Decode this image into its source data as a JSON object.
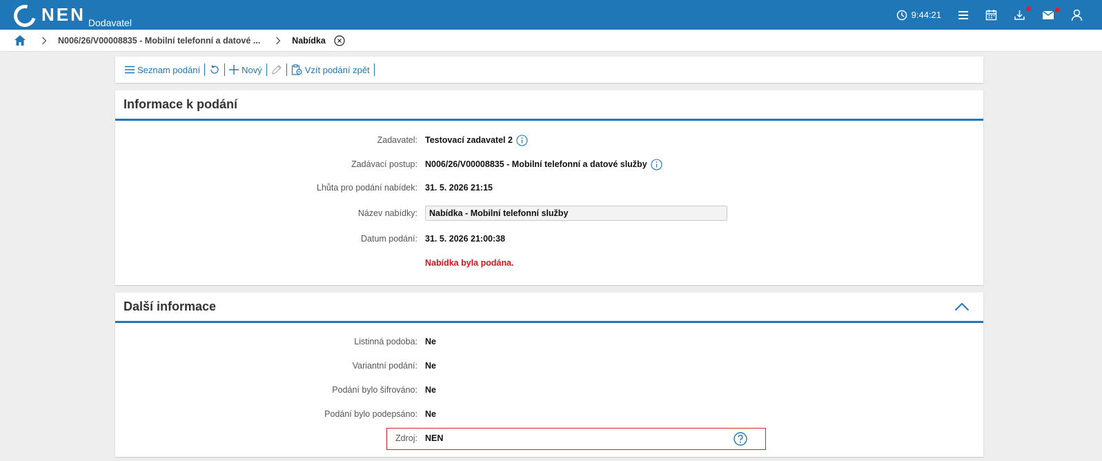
{
  "header": {
    "logo_text": "NEN",
    "logo_sub": "Dodavatel",
    "time": "9:44:21",
    "icons": [
      "clock-icon",
      "menu-icon",
      "calendar-icon",
      "download-icon",
      "mail-icon",
      "user-icon"
    ],
    "accent": "#1f77b8"
  },
  "breadcrumb": {
    "procedure": "N006/26/V00008835 - Mobilní telefonní a datové ...",
    "current": "Nabídka"
  },
  "toolbar": {
    "list_label": "Seznam podání",
    "new_label": "Nový",
    "withdraw_label": "Vzít podání zpět"
  },
  "info": {
    "title": "Informace k podání",
    "fields": [
      {
        "label": "Zadavatel:",
        "value": "Testovací zadavatel 2"
      },
      {
        "label": "Zadávací postup:",
        "value": "N006/26/V00008835 - Mobilní telefonní a datové služby"
      },
      {
        "label": "Lhůta pro podání nabídek:",
        "value": "31. 5. 2026 21:15"
      },
      {
        "label": "Název nabídky:",
        "value": "Nabídka - Mobilní telefonní služby"
      },
      {
        "label": "Datum podání:",
        "value": "31. 5. 2026 21:00:38"
      }
    ],
    "status": "Nabídka byla podána.",
    "status_color": "#e0101a"
  },
  "more": {
    "title": "Další informace",
    "fields": [
      {
        "label": "Listinná podoba:",
        "value": "Ne"
      },
      {
        "label": "Variantní podání:",
        "value": "Ne"
      },
      {
        "label": "Podání bylo šifrováno:",
        "value": "Ne"
      },
      {
        "label": "Podání bylo podepsáno:",
        "value": "Ne"
      },
      {
        "label": "Zdroj:",
        "value": "NEN"
      }
    ]
  }
}
